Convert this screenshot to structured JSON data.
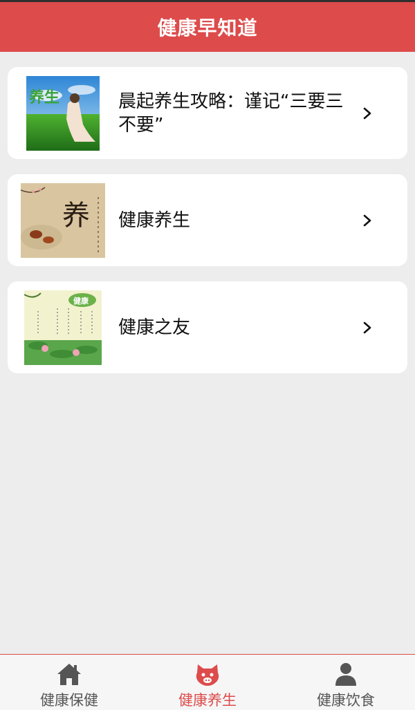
{
  "app": {
    "title": "健康早知道"
  },
  "colors": {
    "accent": "#dd4b4b",
    "tab_inactive": "#555555",
    "background": "#ededed"
  },
  "articles": [
    {
      "title": "晨起养生攻略：谨记“三要三不要”",
      "thumb_icon": "yoga-photo-thumbnail",
      "thumb_text": "养生"
    },
    {
      "title": "健康养生",
      "thumb_icon": "tea-calligraphy-thumbnail",
      "thumb_text": "养"
    },
    {
      "title": "健康之友",
      "thumb_icon": "lotus-poster-thumbnail",
      "thumb_text": "健康"
    }
  ],
  "tabs": [
    {
      "label": "健康保健",
      "icon": "home-icon",
      "active": false
    },
    {
      "label": "健康养生",
      "icon": "pig-face-icon",
      "active": true
    },
    {
      "label": "健康饮食",
      "icon": "person-icon",
      "active": false
    }
  ]
}
